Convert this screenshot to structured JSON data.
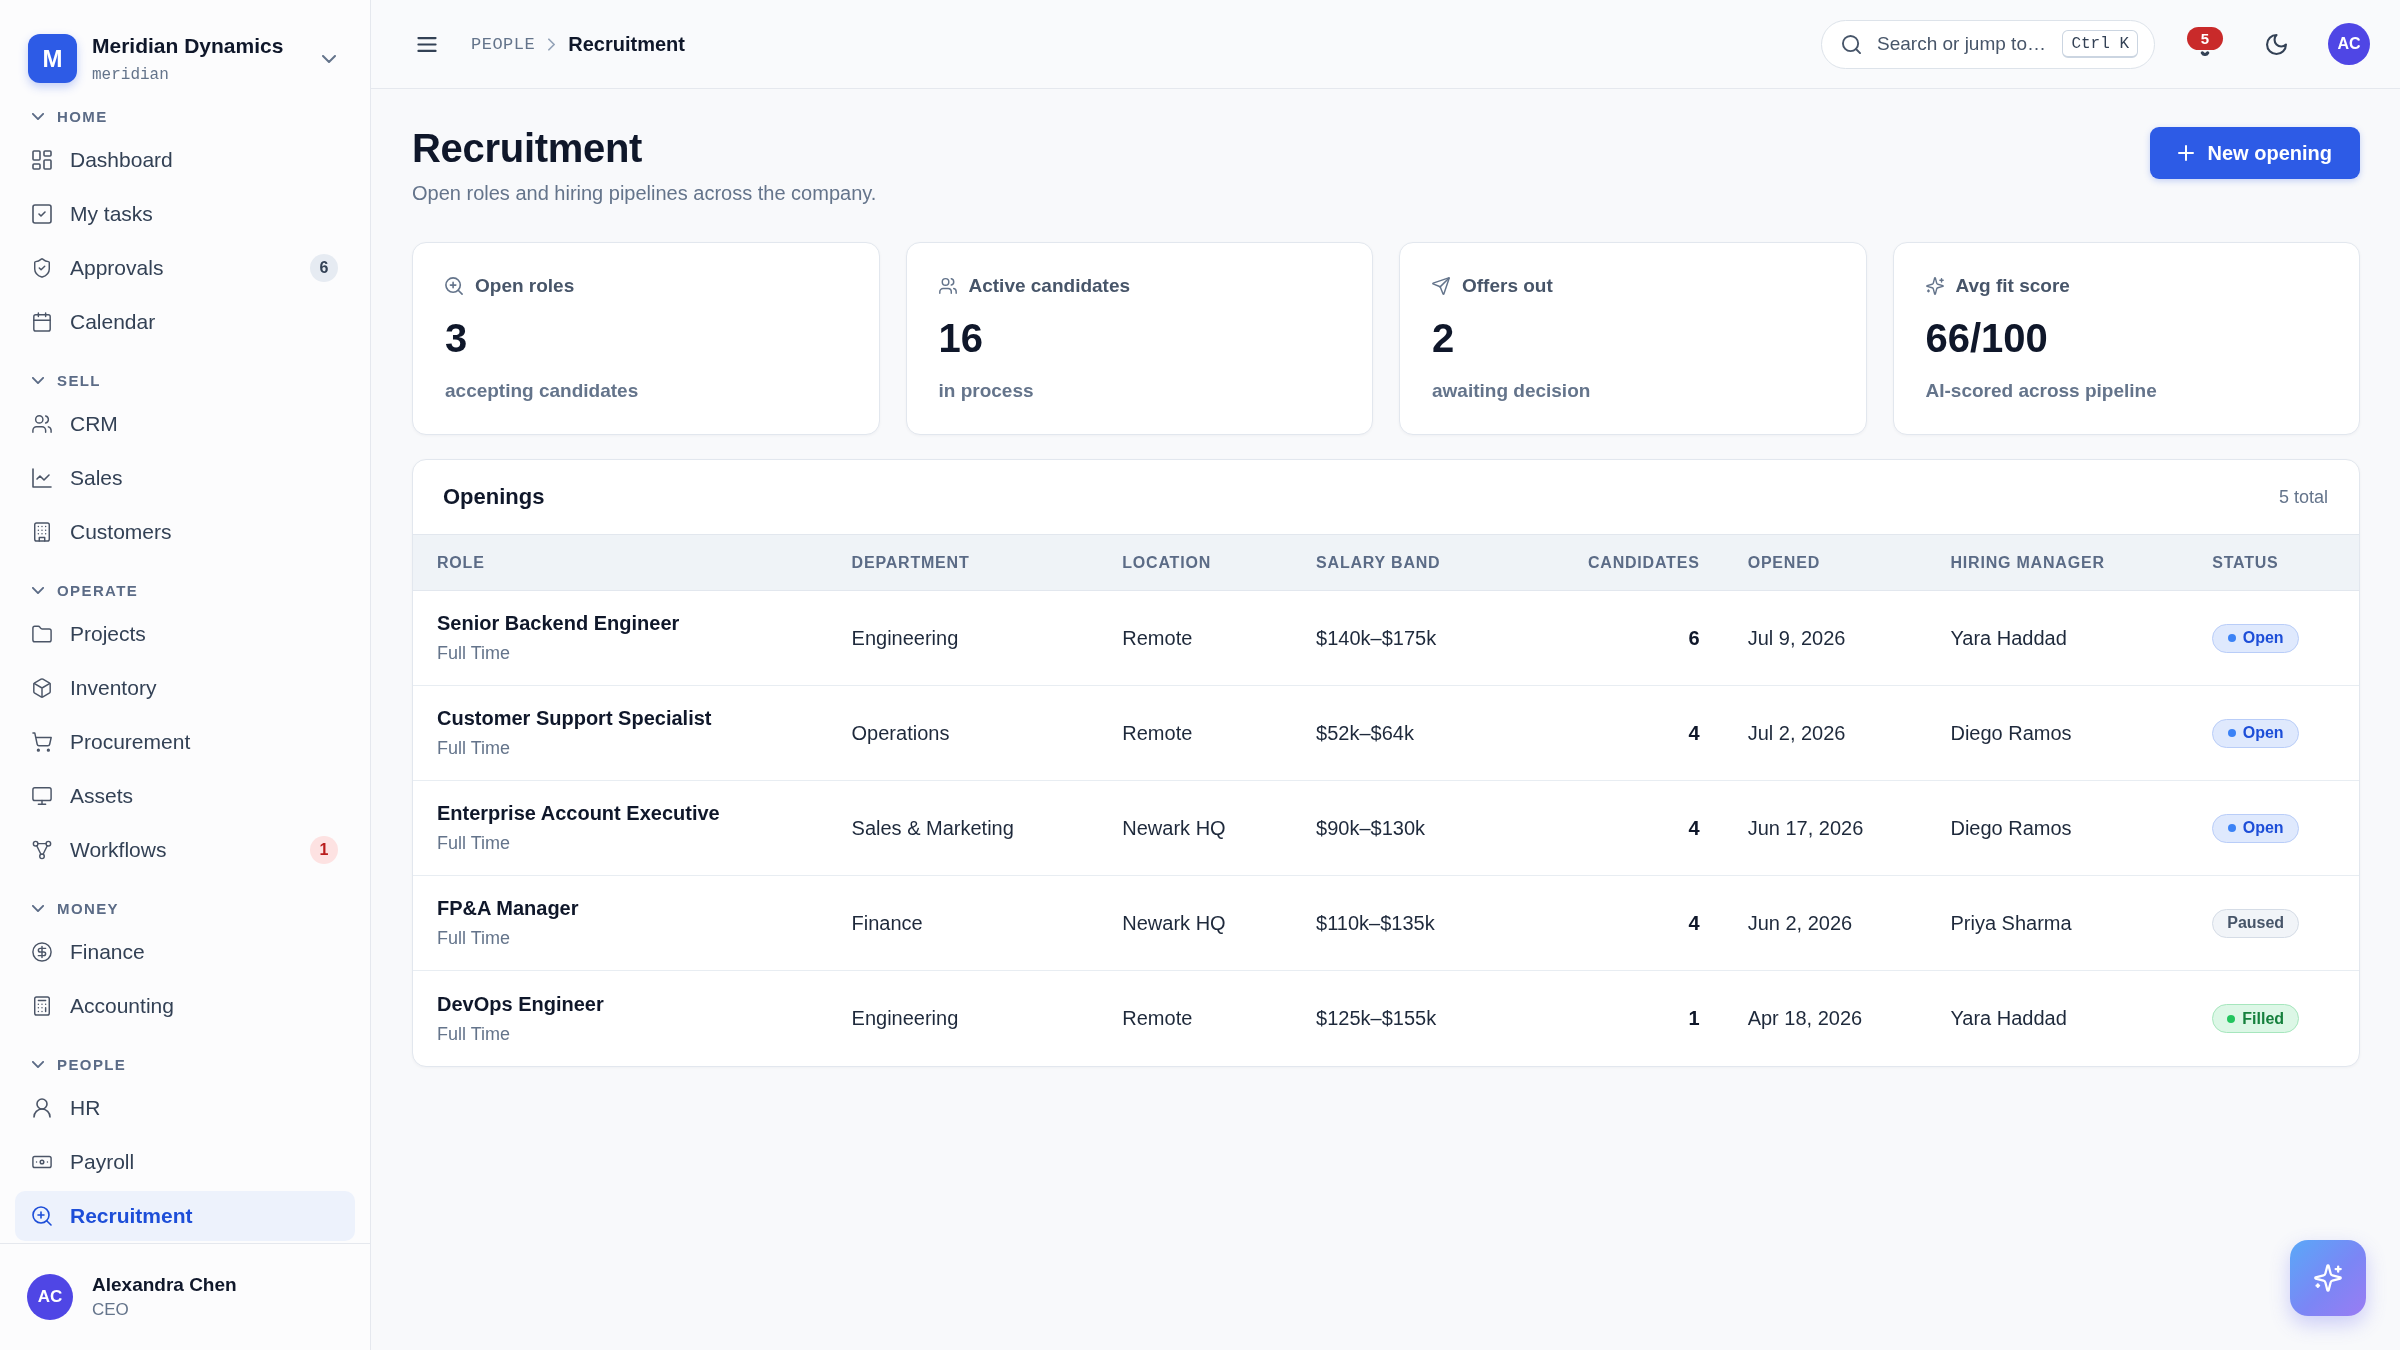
{
  "sidebar": {
    "workspace": {
      "logo_letter": "M",
      "name": "Meridian Dynamics",
      "handle": "meridian"
    },
    "sections": [
      {
        "title": "HOME",
        "expanded": true,
        "items": [
          {
            "label": "Dashboard",
            "selected": false
          },
          {
            "label": "My tasks",
            "selected": false
          },
          {
            "label": "Approvals",
            "selected": false,
            "badge": {
              "count": "6",
              "kind": "neutral"
            }
          },
          {
            "label": "Calendar",
            "selected": false
          }
        ]
      },
      {
        "title": "SELL",
        "expanded": true,
        "items": [
          {
            "label": "CRM",
            "selected": false
          },
          {
            "label": "Sales",
            "selected": false
          },
          {
            "label": "Customers",
            "selected": false
          }
        ]
      },
      {
        "title": "OPERATE",
        "expanded": true,
        "items": [
          {
            "label": "Projects",
            "selected": false
          },
          {
            "label": "Inventory",
            "selected": false
          },
          {
            "label": "Procurement",
            "selected": false
          },
          {
            "label": "Assets",
            "selected": false
          },
          {
            "label": "Workflows",
            "selected": false,
            "badge": {
              "count": "1",
              "kind": "alert"
            }
          }
        ]
      },
      {
        "title": "MONEY",
        "expanded": true,
        "items": [
          {
            "label": "Finance",
            "selected": false
          },
          {
            "label": "Accounting",
            "selected": false
          }
        ]
      },
      {
        "title": "PEOPLE",
        "expanded": true,
        "items": [
          {
            "label": "HR",
            "selected": false
          },
          {
            "label": "Payroll",
            "selected": false
          },
          {
            "label": "Recruitment",
            "selected": true
          }
        ]
      }
    ],
    "user": {
      "initials": "AC",
      "name": "Alexandra Chen",
      "role": "CEO"
    }
  },
  "topbar": {
    "breadcrumb": [
      "PEOPLE",
      "Recruitment"
    ],
    "search": {
      "placeholder": "Search or jump to…",
      "shortcut": "Ctrl K"
    },
    "notifications": {
      "count": "5"
    },
    "avatar_initials": "AC"
  },
  "page": {
    "title": "Recruitment",
    "subtitle": "Open roles and hiring pipelines across the company.",
    "primary_action": {
      "label": "New opening"
    }
  },
  "stats": [
    {
      "label": "Open roles",
      "value": "3",
      "caption": "accepting candidates"
    },
    {
      "label": "Active candidates",
      "value": "16",
      "caption": "in process"
    },
    {
      "label": "Offers out",
      "value": "2",
      "caption": "awaiting decision"
    },
    {
      "label": "Avg fit score",
      "value": "66/100",
      "caption": "AI-scored across pipeline"
    }
  ],
  "openings": {
    "title": "Openings",
    "total": "5 total",
    "columns": [
      "ROLE",
      "DEPARTMENT",
      "LOCATION",
      "SALARY BAND",
      "CANDIDATES",
      "OPENED",
      "HIRING MANAGER",
      "STATUS"
    ],
    "rows": [
      {
        "role": "Senior Backend Engineer",
        "employment_type": "Full Time",
        "department": "Engineering",
        "location": "Remote",
        "salary_band": "$140k–$175k",
        "candidates": "6",
        "opened": "Jul 9, 2026",
        "hiring_manager": "Yara Haddad",
        "status": {
          "label": "Open",
          "kind": "open"
        }
      },
      {
        "role": "Customer Support Specialist",
        "employment_type": "Full Time",
        "department": "Operations",
        "location": "Remote",
        "salary_band": "$52k–$64k",
        "candidates": "4",
        "opened": "Jul 2, 2026",
        "hiring_manager": "Diego Ramos",
        "status": {
          "label": "Open",
          "kind": "open"
        }
      },
      {
        "role": "Enterprise Account Executive",
        "employment_type": "Full Time",
        "department": "Sales & Marketing",
        "location": "Newark HQ",
        "salary_band": "$90k–$130k",
        "candidates": "4",
        "opened": "Jun 17, 2026",
        "hiring_manager": "Diego Ramos",
        "status": {
          "label": "Open",
          "kind": "open"
        }
      },
      {
        "role": "FP&A Manager",
        "employment_type": "Full Time",
        "department": "Finance",
        "location": "Newark HQ",
        "salary_band": "$110k–$135k",
        "candidates": "4",
        "opened": "Jun 2, 2026",
        "hiring_manager": "Priya Sharma",
        "status": {
          "label": "Paused",
          "kind": "paused"
        }
      },
      {
        "role": "DevOps Engineer",
        "employment_type": "Full Time",
        "department": "Engineering",
        "location": "Remote",
        "salary_band": "$125k–$155k",
        "candidates": "1",
        "opened": "Apr 18, 2026",
        "hiring_manager": "Yara Haddad",
        "status": {
          "label": "Filled",
          "kind": "filled"
        }
      }
    ]
  }
}
